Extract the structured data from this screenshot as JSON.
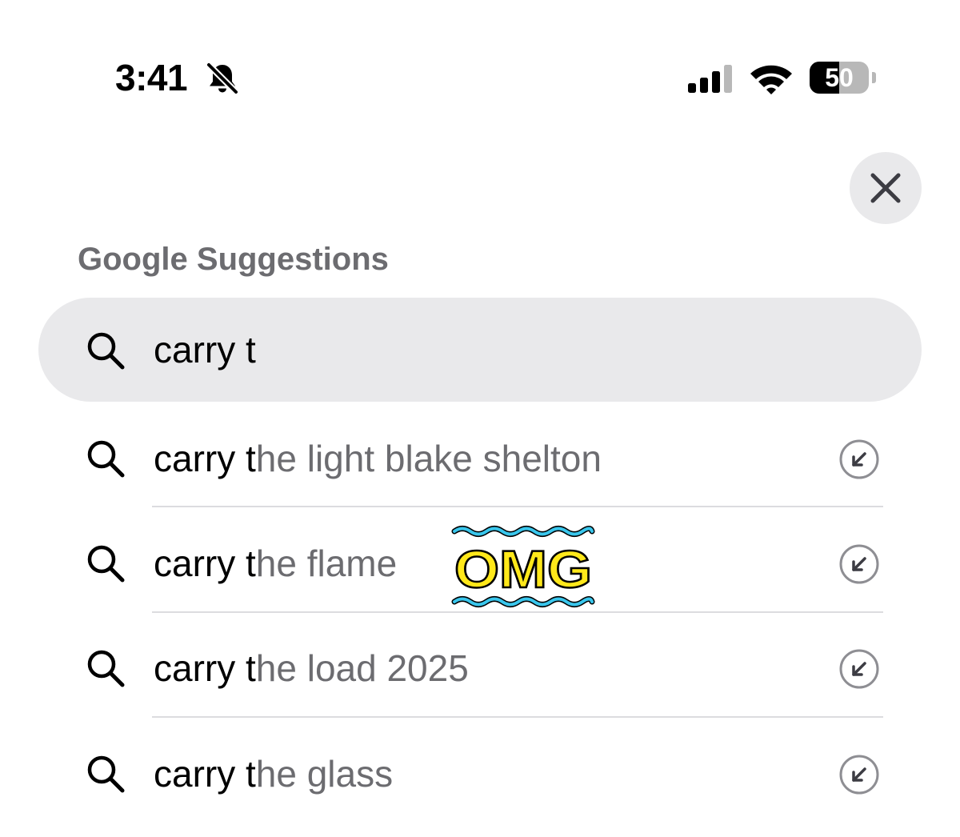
{
  "status_bar": {
    "time": "3:41",
    "battery": "50",
    "battery_level": 0.5,
    "icons": [
      "bell-slash-icon",
      "cellular-signal-icon",
      "wifi-icon",
      "battery-icon"
    ]
  },
  "close_button": {
    "icon": "close-icon"
  },
  "section_title": "Google Suggestions",
  "search": {
    "value": "carry t",
    "icon": "search-icon"
  },
  "suggestions": [
    {
      "typed": "carry t",
      "rest": "he light blake shelton"
    },
    {
      "typed": "carry t",
      "rest": "he flame"
    },
    {
      "typed": "carry t",
      "rest": "he load 2025"
    },
    {
      "typed": "carry t",
      "rest": "he glass"
    }
  ],
  "sticker": {
    "text": "OMG",
    "fill": "#ffe81a",
    "wave_color": "#39c6ec"
  },
  "colors": {
    "field_bg": "#e9e9eb",
    "secondary_text": "#6c6c70",
    "divider": "#dcdcdf"
  }
}
